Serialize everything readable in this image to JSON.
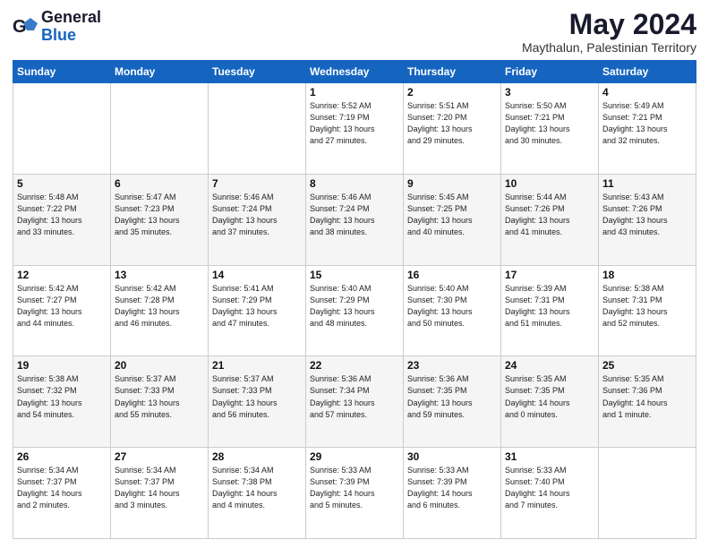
{
  "header": {
    "logo_general": "General",
    "logo_blue": "Blue",
    "month_title": "May 2024",
    "subtitle": "Maythalun, Palestinian Territory"
  },
  "days_of_week": [
    "Sunday",
    "Monday",
    "Tuesday",
    "Wednesday",
    "Thursday",
    "Friday",
    "Saturday"
  ],
  "weeks": [
    [
      {
        "day": "",
        "info": ""
      },
      {
        "day": "",
        "info": ""
      },
      {
        "day": "",
        "info": ""
      },
      {
        "day": "1",
        "info": "Sunrise: 5:52 AM\nSunset: 7:19 PM\nDaylight: 13 hours\nand 27 minutes."
      },
      {
        "day": "2",
        "info": "Sunrise: 5:51 AM\nSunset: 7:20 PM\nDaylight: 13 hours\nand 29 minutes."
      },
      {
        "day": "3",
        "info": "Sunrise: 5:50 AM\nSunset: 7:21 PM\nDaylight: 13 hours\nand 30 minutes."
      },
      {
        "day": "4",
        "info": "Sunrise: 5:49 AM\nSunset: 7:21 PM\nDaylight: 13 hours\nand 32 minutes."
      }
    ],
    [
      {
        "day": "5",
        "info": "Sunrise: 5:48 AM\nSunset: 7:22 PM\nDaylight: 13 hours\nand 33 minutes."
      },
      {
        "day": "6",
        "info": "Sunrise: 5:47 AM\nSunset: 7:23 PM\nDaylight: 13 hours\nand 35 minutes."
      },
      {
        "day": "7",
        "info": "Sunrise: 5:46 AM\nSunset: 7:24 PM\nDaylight: 13 hours\nand 37 minutes."
      },
      {
        "day": "8",
        "info": "Sunrise: 5:46 AM\nSunset: 7:24 PM\nDaylight: 13 hours\nand 38 minutes."
      },
      {
        "day": "9",
        "info": "Sunrise: 5:45 AM\nSunset: 7:25 PM\nDaylight: 13 hours\nand 40 minutes."
      },
      {
        "day": "10",
        "info": "Sunrise: 5:44 AM\nSunset: 7:26 PM\nDaylight: 13 hours\nand 41 minutes."
      },
      {
        "day": "11",
        "info": "Sunrise: 5:43 AM\nSunset: 7:26 PM\nDaylight: 13 hours\nand 43 minutes."
      }
    ],
    [
      {
        "day": "12",
        "info": "Sunrise: 5:42 AM\nSunset: 7:27 PM\nDaylight: 13 hours\nand 44 minutes."
      },
      {
        "day": "13",
        "info": "Sunrise: 5:42 AM\nSunset: 7:28 PM\nDaylight: 13 hours\nand 46 minutes."
      },
      {
        "day": "14",
        "info": "Sunrise: 5:41 AM\nSunset: 7:29 PM\nDaylight: 13 hours\nand 47 minutes."
      },
      {
        "day": "15",
        "info": "Sunrise: 5:40 AM\nSunset: 7:29 PM\nDaylight: 13 hours\nand 48 minutes."
      },
      {
        "day": "16",
        "info": "Sunrise: 5:40 AM\nSunset: 7:30 PM\nDaylight: 13 hours\nand 50 minutes."
      },
      {
        "day": "17",
        "info": "Sunrise: 5:39 AM\nSunset: 7:31 PM\nDaylight: 13 hours\nand 51 minutes."
      },
      {
        "day": "18",
        "info": "Sunrise: 5:38 AM\nSunset: 7:31 PM\nDaylight: 13 hours\nand 52 minutes."
      }
    ],
    [
      {
        "day": "19",
        "info": "Sunrise: 5:38 AM\nSunset: 7:32 PM\nDaylight: 13 hours\nand 54 minutes."
      },
      {
        "day": "20",
        "info": "Sunrise: 5:37 AM\nSunset: 7:33 PM\nDaylight: 13 hours\nand 55 minutes."
      },
      {
        "day": "21",
        "info": "Sunrise: 5:37 AM\nSunset: 7:33 PM\nDaylight: 13 hours\nand 56 minutes."
      },
      {
        "day": "22",
        "info": "Sunrise: 5:36 AM\nSunset: 7:34 PM\nDaylight: 13 hours\nand 57 minutes."
      },
      {
        "day": "23",
        "info": "Sunrise: 5:36 AM\nSunset: 7:35 PM\nDaylight: 13 hours\nand 59 minutes."
      },
      {
        "day": "24",
        "info": "Sunrise: 5:35 AM\nSunset: 7:35 PM\nDaylight: 14 hours\nand 0 minutes."
      },
      {
        "day": "25",
        "info": "Sunrise: 5:35 AM\nSunset: 7:36 PM\nDaylight: 14 hours\nand 1 minute."
      }
    ],
    [
      {
        "day": "26",
        "info": "Sunrise: 5:34 AM\nSunset: 7:37 PM\nDaylight: 14 hours\nand 2 minutes."
      },
      {
        "day": "27",
        "info": "Sunrise: 5:34 AM\nSunset: 7:37 PM\nDaylight: 14 hours\nand 3 minutes."
      },
      {
        "day": "28",
        "info": "Sunrise: 5:34 AM\nSunset: 7:38 PM\nDaylight: 14 hours\nand 4 minutes."
      },
      {
        "day": "29",
        "info": "Sunrise: 5:33 AM\nSunset: 7:39 PM\nDaylight: 14 hours\nand 5 minutes."
      },
      {
        "day": "30",
        "info": "Sunrise: 5:33 AM\nSunset: 7:39 PM\nDaylight: 14 hours\nand 6 minutes."
      },
      {
        "day": "31",
        "info": "Sunrise: 5:33 AM\nSunset: 7:40 PM\nDaylight: 14 hours\nand 7 minutes."
      },
      {
        "day": "",
        "info": ""
      }
    ]
  ]
}
